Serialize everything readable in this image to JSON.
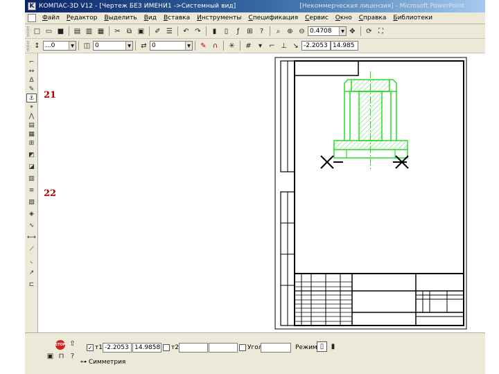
{
  "window": {
    "title": "КОМПАС-3D V12 - [Чертеж БЕЗ ИМЕНИ1 ->Системный вид]",
    "title_right": "[Некоммерческая лицензия] - Microsoft PowerPoint"
  },
  "menu": [
    "Файл",
    "Редактор",
    "Выделить",
    "Вид",
    "Вставка",
    "Инструменты",
    "Спецификация",
    "Сервис",
    "Окно",
    "Справка",
    "Библиотеки"
  ],
  "toolbar1": {
    "zoom_value": "0.4708"
  },
  "toolbar2": {
    "style_value": "...0",
    "layer_value": "0",
    "scale_value": "0",
    "coord_x": "-2.2053",
    "coord_y": "14.985"
  },
  "workspace": {
    "note_21": "21",
    "note_22": "22"
  },
  "bottom": {
    "point_label": "т1",
    "x_value": "-2.2053",
    "y_value": "14.9858",
    "point2_label": "т2",
    "angle_label": "Угол",
    "mode_label": "Режим",
    "tab_label": "Симметрия",
    "stop_label": "STOP"
  }
}
